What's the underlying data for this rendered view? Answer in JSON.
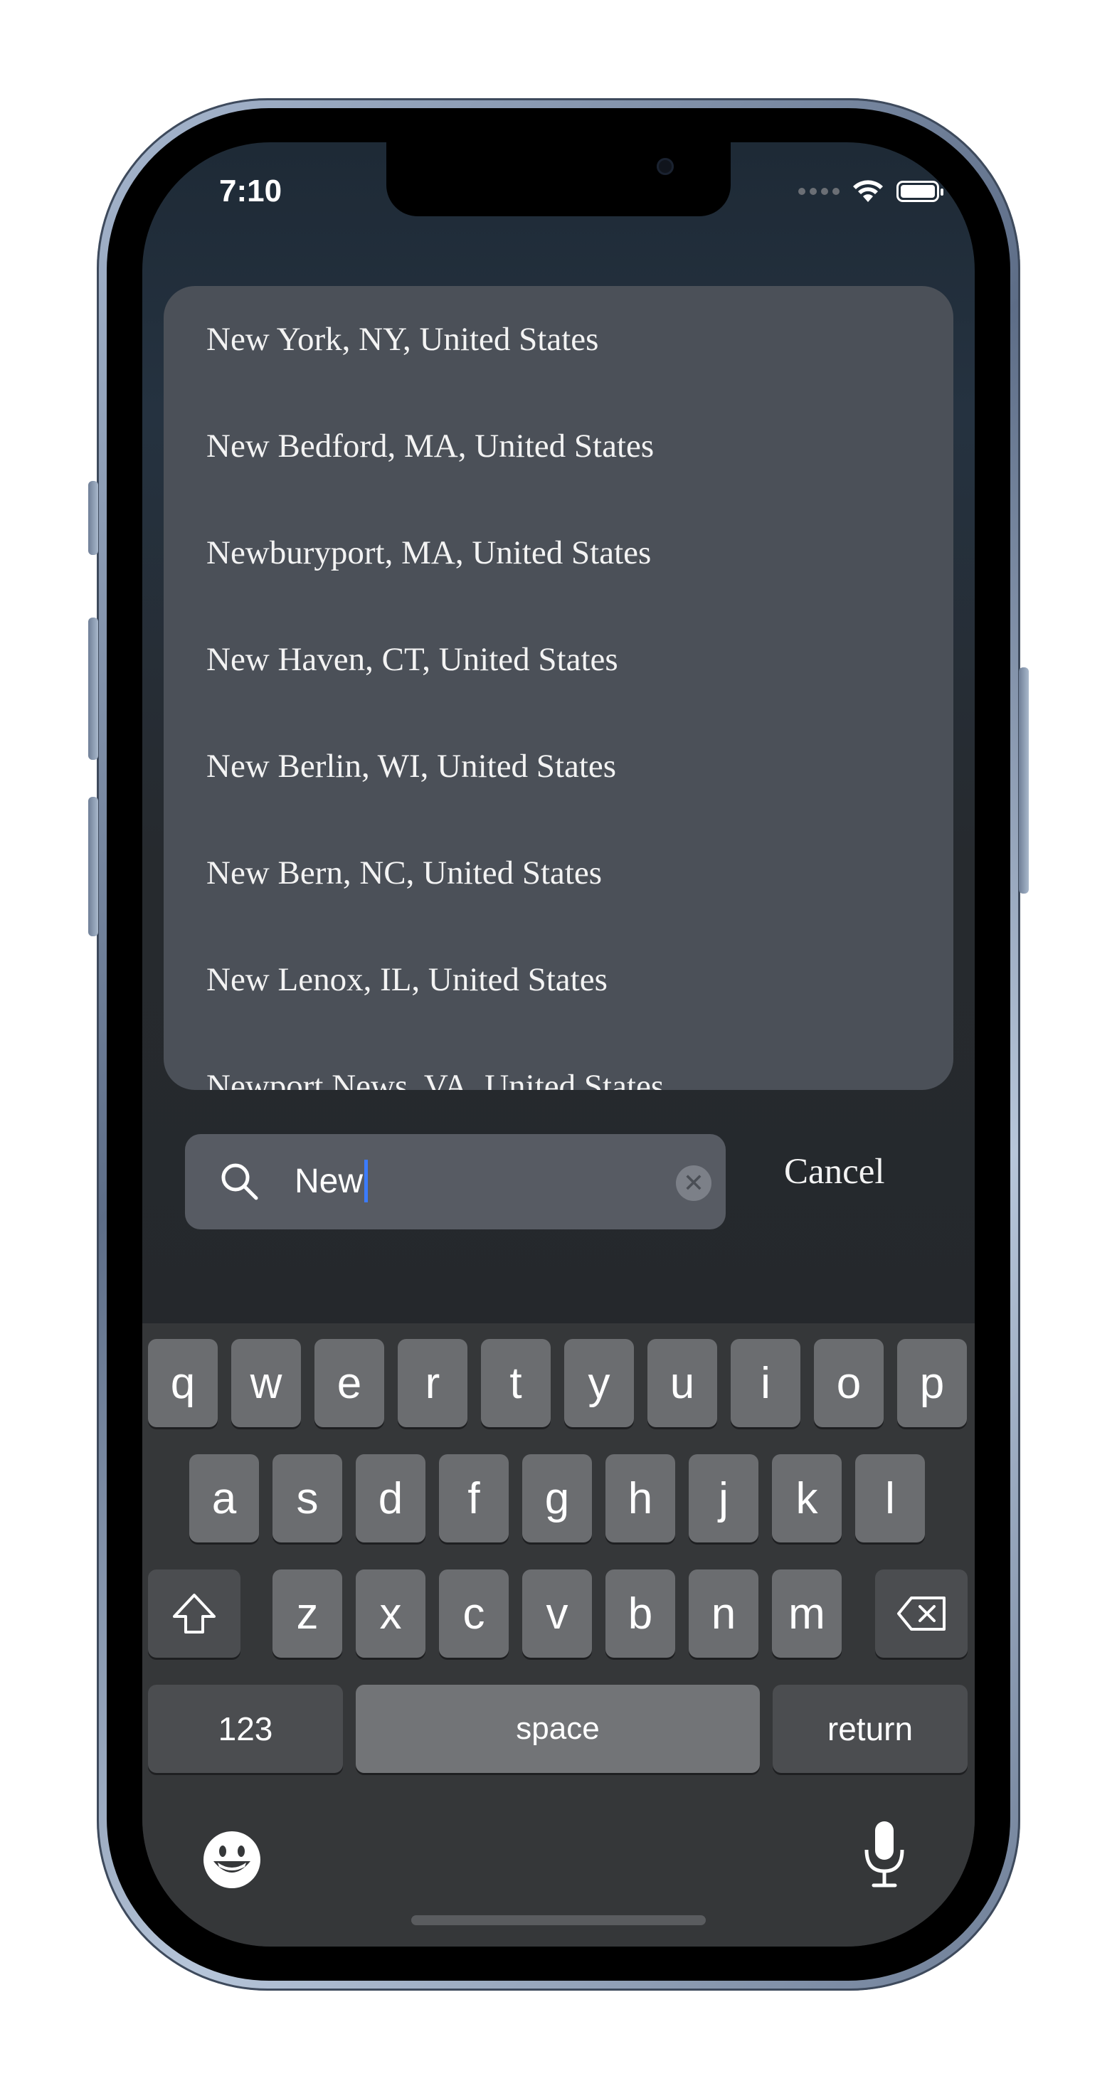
{
  "status_bar": {
    "time": "7:10"
  },
  "suggestions": [
    "New York, NY, United States",
    "New Bedford, MA, United States",
    "Newburyport, MA, United States",
    "New Haven, CT, United States",
    "New Berlin, WI, United States",
    "New Bern, NC, United States",
    "New Lenox, IL, United States",
    "Newport News, VA, United States"
  ],
  "search": {
    "value": "New",
    "cancel_label": "Cancel"
  },
  "keyboard": {
    "row1": [
      "q",
      "w",
      "e",
      "r",
      "t",
      "y",
      "u",
      "i",
      "o",
      "p"
    ],
    "row2": [
      "a",
      "s",
      "d",
      "f",
      "g",
      "h",
      "j",
      "k",
      "l"
    ],
    "row3": [
      "z",
      "x",
      "c",
      "v",
      "b",
      "n",
      "m"
    ],
    "numbers_label": "123",
    "space_label": "space",
    "return_label": "return"
  },
  "icons": [
    "search-icon",
    "clear-icon",
    "shift-icon",
    "delete-icon",
    "emoji-icon",
    "microphone-icon",
    "wifi-icon",
    "battery-icon"
  ],
  "colors": {
    "accent_caret": "#3b7bff",
    "card_bg": "#4b5058"
  }
}
